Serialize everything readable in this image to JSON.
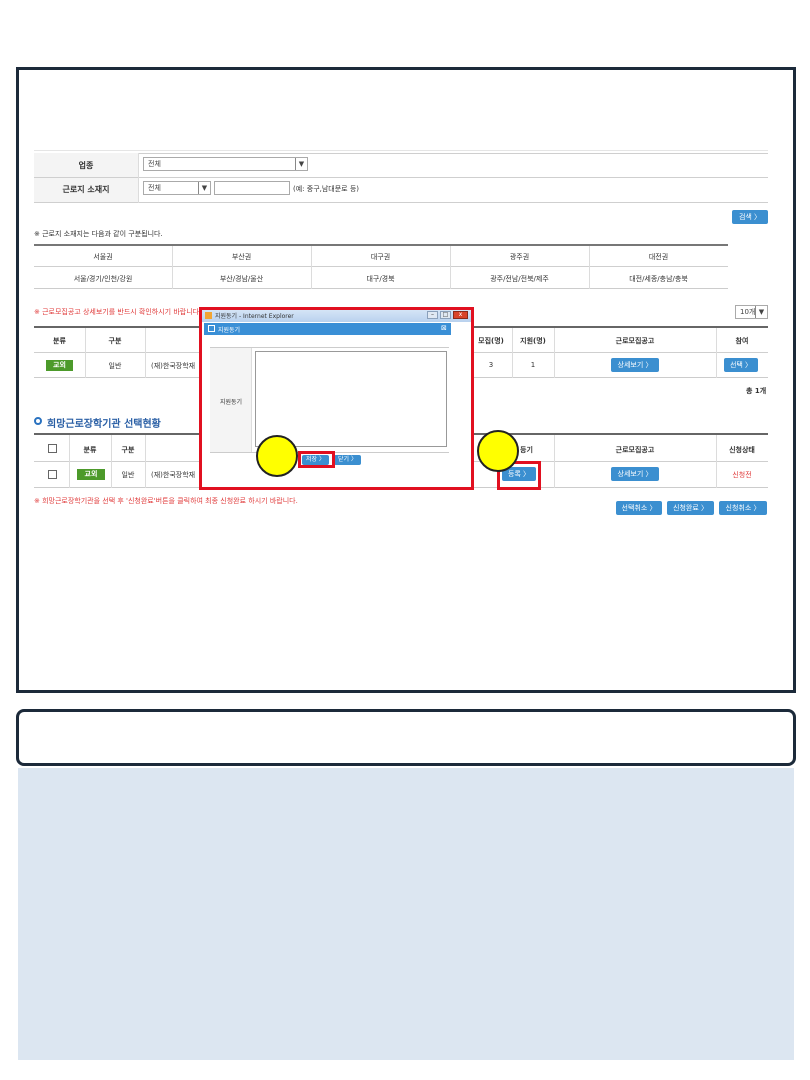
{
  "form": {
    "industry_label": "업종",
    "industry_value": "전체",
    "location_label": "근로지 소재지",
    "location_value": "전체",
    "location_hint": "(예: 중구,남대문로 등)",
    "search_btn": "검색 〉"
  },
  "region_note": "※ 근로지 소재지는 다음과 같이 구분됩니다.",
  "regions": [
    {
      "name": "서울권",
      "detail": "서울/경기/인천/강원"
    },
    {
      "name": "부산권",
      "detail": "부산/경남/울산"
    },
    {
      "name": "대구권",
      "detail": "대구/경북"
    },
    {
      "name": "광주권",
      "detail": "광주/전남/전북/제주"
    },
    {
      "name": "대전권",
      "detail": "대전/세종/충남/충북"
    }
  ],
  "notice": "※ 근로모집공고 상세보기를 반드시 확인하시기 바랍니다.",
  "page_size": "10개",
  "table1": {
    "headers": [
      "분류",
      "구분",
      "모집(명)",
      "지원(명)",
      "근로모집공고",
      "참여"
    ],
    "row": {
      "tag": "교외",
      "type": "일반",
      "org": "(재)한국장학재",
      "recruit": "3",
      "applied": "1",
      "detail_btn": "상세보기 〉",
      "select_btn": "선택 〉"
    }
  },
  "total": "총 1개",
  "section_title": "희망근로장학기관 선택현황",
  "table2": {
    "headers": [
      "분류",
      "구분",
      "등기",
      "근로모집공고",
      "신청상태"
    ],
    "row": {
      "tag": "교외",
      "type": "일반",
      "org": "(재)한국장학재",
      "reg_btn": "등록 〉",
      "detail_btn": "상세보기 〉",
      "status": "신청전"
    }
  },
  "bottom_notice": "※ 희망근로장학기관을 선택 후 '신청완료'버튼을 클릭하여 최종 신청완료 하시기 바랍니다.",
  "bottom_btns": [
    "선택취소 〉",
    "신청완료 〉",
    "신청취소 〉"
  ],
  "popup": {
    "window_title": "지원동기 - Internet Explorer",
    "inner_title": "지원동기",
    "field_label": "지원동기",
    "save_btn": "저장 〉",
    "close_btn": "닫기 〉"
  },
  "colors": {
    "highlight": "#e11020",
    "button": "#3b8fd0",
    "tag": "#4c9a2a",
    "marker": "#ffff00"
  }
}
